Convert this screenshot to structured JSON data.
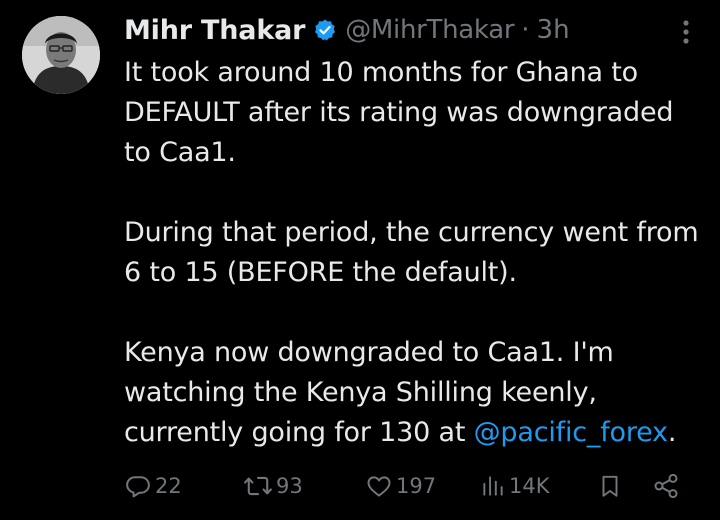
{
  "tweet": {
    "author": {
      "display_name": "Mihr Thakar",
      "handle": "@MihrThakar",
      "separator": "·",
      "time": "3h",
      "verified": true
    },
    "body": {
      "para1": "It took around 10 months for Ghana to DEFAULT after its rating was downgraded to Caa1.",
      "para2": "During that period, the currency went from 6 to 15 (BEFORE the default).",
      "para3_text": "Kenya now downgraded to Caa1. I'm watching the Kenya Shilling keenly, currently going for 130 at ",
      "para3_mention": "@pacific_forex",
      "para3_end": "."
    },
    "actions": {
      "replies": "22",
      "reposts": "93",
      "likes": "197",
      "views": "14K"
    }
  },
  "colors": {
    "background": "#000000",
    "text": "#e7e9ea",
    "muted": "#71767b",
    "accent": "#1d9bf0"
  },
  "icons": {
    "verified": "verified-badge-icon",
    "more": "more-options-icon",
    "reply": "reply-icon",
    "repost": "repost-icon",
    "like": "heart-icon",
    "views": "views-icon",
    "bookmark": "bookmark-icon",
    "share": "share-icon"
  }
}
